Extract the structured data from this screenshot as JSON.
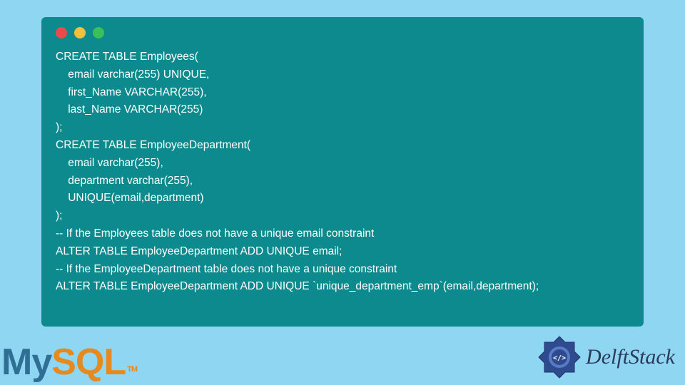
{
  "code": "CREATE TABLE Employees(\n    email varchar(255) UNIQUE,\n    first_Name VARCHAR(255),\n    last_Name VARCHAR(255)\n);\nCREATE TABLE EmployeeDepartment(\n    email varchar(255),\n    department varchar(255),\n    UNIQUE(email,department)\n);\n-- If the Employees table does not have a unique email constraint\nALTER TABLE EmployeeDepartment ADD UNIQUE email;\n-- If the EmployeeDepartment table does not have a unique constraint\nALTER TABLE EmployeeDepartment ADD UNIQUE `unique_department_emp`(email,department);",
  "mysql": {
    "my": "My",
    "sql": "SQL",
    "tm": "TM"
  },
  "delft": {
    "text": "DelftStack"
  },
  "colors": {
    "page_bg": "#8fd6f2",
    "code_bg": "#0d8a8e",
    "code_fg": "#ffffff",
    "dot_red": "#e94b4b",
    "dot_yellow": "#f3c03e",
    "dot_green": "#3bbf5a",
    "mysql_my": "#2f6f93",
    "mysql_sql": "#e68a1f",
    "delft_blue": "#2b3a5a"
  }
}
